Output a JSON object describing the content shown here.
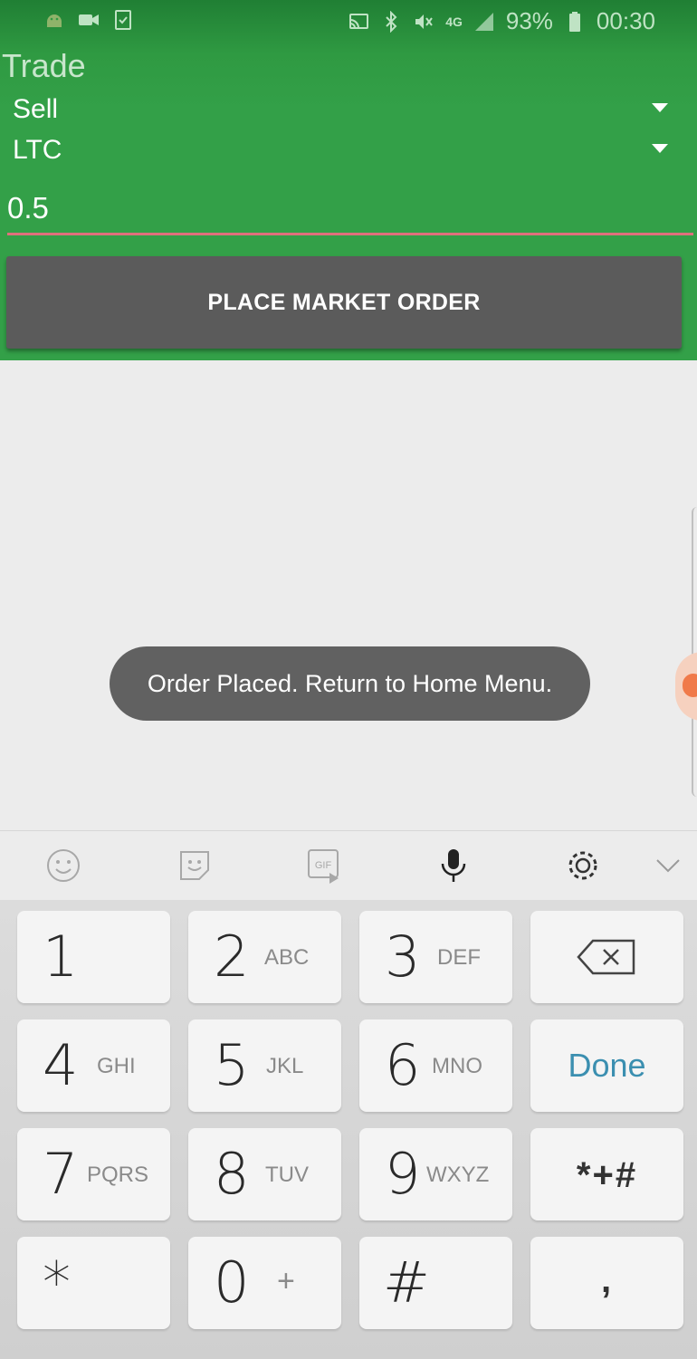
{
  "status_bar": {
    "left_icons": [
      "android-icon",
      "video-camera-icon",
      "checklist-icon"
    ],
    "right_icons": [
      "cast-icon",
      "bluetooth-icon",
      "mute-icon",
      "data-4g-icon",
      "signal-icon",
      "battery-icon"
    ],
    "network": "4G",
    "battery": "93%",
    "time": "00:30"
  },
  "trade": {
    "title": "Trade",
    "side": "Sell",
    "currency": "LTC",
    "amount": "0.5",
    "order_button": "PLACE MARKET ORDER"
  },
  "toast": {
    "message": "Order Placed. Return to Home Menu."
  },
  "keyboard_toolbar": {
    "icons": [
      "emoji-icon",
      "sticker-icon",
      "gif-icon",
      "microphone-icon",
      "settings-icon",
      "chevron-down-icon"
    ],
    "gif_label": "GIF"
  },
  "keyboard": {
    "rows": [
      [
        {
          "digit": "1",
          "letters": ""
        },
        {
          "digit": "2",
          "letters": "ABC"
        },
        {
          "digit": "3",
          "letters": "DEF"
        },
        {
          "special": "backspace"
        }
      ],
      [
        {
          "digit": "4",
          "letters": "GHI"
        },
        {
          "digit": "5",
          "letters": "JKL"
        },
        {
          "digit": "6",
          "letters": "MNO"
        },
        {
          "label": "Done"
        }
      ],
      [
        {
          "digit": "7",
          "letters": "PQRS"
        },
        {
          "digit": "8",
          "letters": "TUV"
        },
        {
          "digit": "9",
          "letters": "WXYZ"
        },
        {
          "label": "*+#"
        }
      ],
      [
        {
          "digit": "*",
          "letters": ""
        },
        {
          "digit": "0",
          "letters": "+"
        },
        {
          "digit": "#",
          "letters": ""
        },
        {
          "label": ","
        }
      ]
    ]
  },
  "colors": {
    "header_green": "#33a048",
    "button_gray": "#5b5b5b",
    "underline_accent": "#e0707c",
    "done_blue": "#3b8fb0"
  }
}
